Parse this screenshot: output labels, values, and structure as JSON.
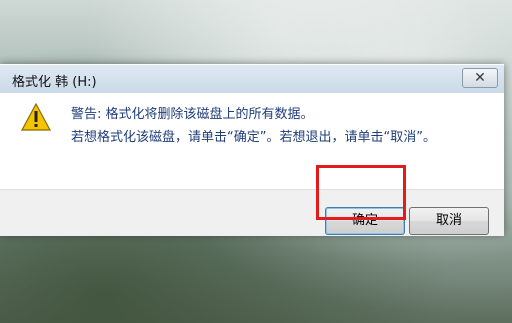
{
  "dialog": {
    "title": "格式化 韩 (H:)",
    "close_symbol": "✕",
    "message_line1": "警告: 格式化将删除该磁盘上的所有数据。",
    "message_line2": "若想格式化该磁盘，请单击“确定”。若想退出，请单击“取消”。",
    "ok_label": "确定",
    "cancel_label": "取消",
    "icon": "warning-icon"
  },
  "colors": {
    "highlight": "#e21b1b",
    "message_text": "#1f3d7a",
    "titlebar": "#cad9e8"
  }
}
